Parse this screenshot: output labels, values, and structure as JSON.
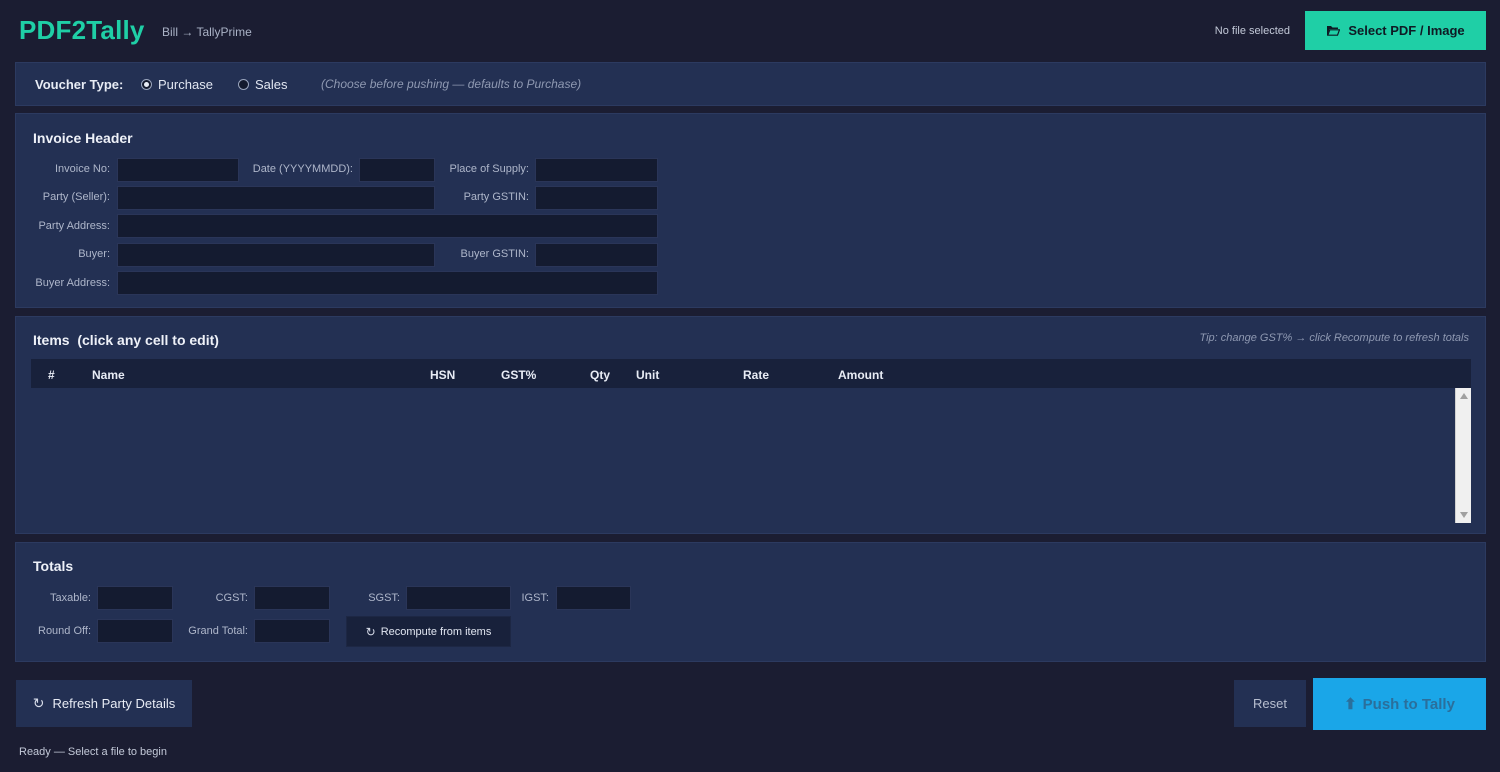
{
  "app": {
    "title": "PDF2Tally",
    "subtitle": "Bill → TallyPrime",
    "file_status": "No file selected",
    "select_button_label": "Select PDF / Image"
  },
  "voucher": {
    "label": "Voucher Type:",
    "options": [
      {
        "label": "Purchase",
        "selected": true
      },
      {
        "label": "Sales",
        "selected": false
      }
    ],
    "hint": "(Choose before pushing — defaults to Purchase)"
  },
  "invoice_header": {
    "title": "Invoice Header",
    "fields": {
      "invoice_no": {
        "label": "Invoice No:",
        "value": ""
      },
      "date": {
        "label": "Date (YYYYMMDD):",
        "value": ""
      },
      "place_of_supply": {
        "label": "Place of Supply:",
        "value": ""
      },
      "party_seller": {
        "label": "Party (Seller):",
        "value": ""
      },
      "party_gstin": {
        "label": "Party GSTIN:",
        "value": ""
      },
      "party_address": {
        "label": "Party Address:",
        "value": ""
      },
      "buyer": {
        "label": "Buyer:",
        "value": ""
      },
      "buyer_gstin": {
        "label": "Buyer GSTIN:",
        "value": ""
      },
      "buyer_address": {
        "label": "Buyer Address:",
        "value": ""
      }
    }
  },
  "items": {
    "title": "Items  (click any cell to edit)",
    "tip": "Tip: change GST% → click Recompute to refresh totals",
    "columns": [
      "#",
      "Name",
      "HSN",
      "GST%",
      "Qty",
      "Unit",
      "Rate",
      "Amount"
    ],
    "rows": []
  },
  "totals": {
    "title": "Totals",
    "fields": {
      "taxable": {
        "label": "Taxable:",
        "value": ""
      },
      "cgst": {
        "label": "CGST:",
        "value": ""
      },
      "sgst": {
        "label": "SGST:",
        "value": ""
      },
      "igst": {
        "label": "IGST:",
        "value": ""
      },
      "round_off": {
        "label": "Round Off:",
        "value": ""
      },
      "grand_total": {
        "label": "Grand Total:",
        "value": ""
      }
    },
    "recompute_label": "Recompute from items"
  },
  "actions": {
    "refresh_label": "Refresh Party Details",
    "reset_label": "Reset",
    "push_label": "Push to Tally",
    "refresh_icon": "↻",
    "push_icon": "⬆"
  },
  "status": "Ready — Select a file to begin",
  "colors": {
    "accent": "#1fcfa6",
    "push": "#1aa6e8",
    "background": "#1b1d32",
    "panel": "#233053"
  }
}
